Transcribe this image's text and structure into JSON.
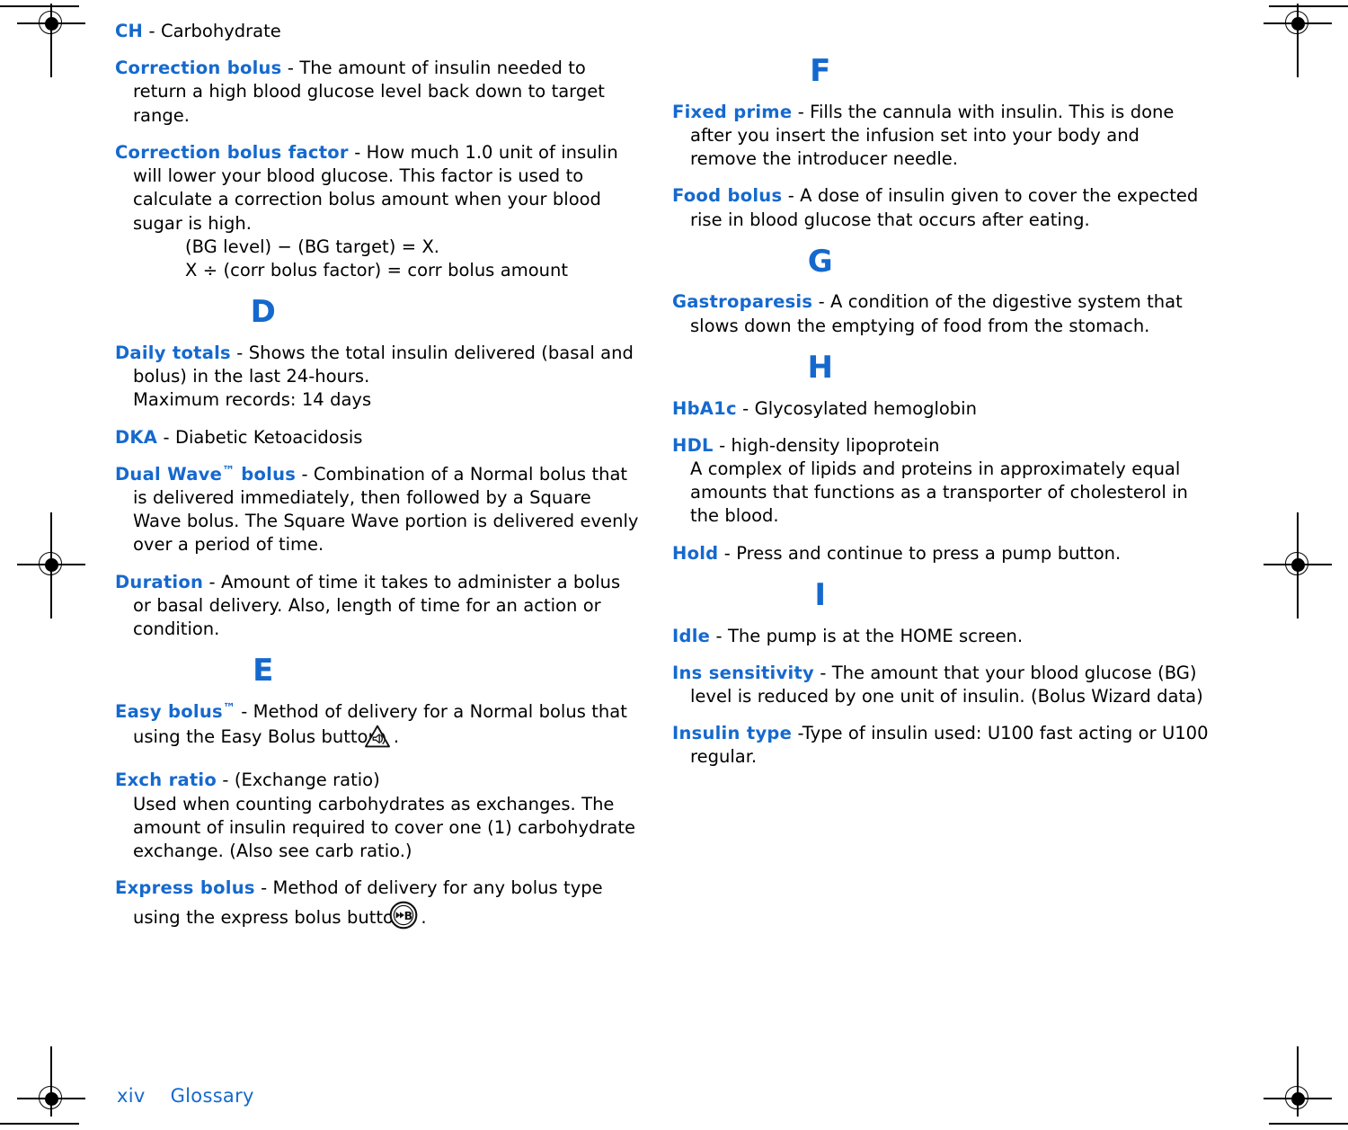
{
  "document": {
    "footer": {
      "page_number": "xiv",
      "section": "Glossary"
    }
  },
  "left_column": {
    "entries": [
      {
        "term": "CH",
        "definition": " - Carbohydrate"
      },
      {
        "term": "Correction bolus",
        "definition": " - The amount of insulin needed to return a high blood glucose level back down to target range."
      },
      {
        "term": "Correction bolus factor",
        "definition": " - How much 1.0 unit of insulin will lower your blood glucose. This factor is used to calculate a correction bolus amount when your blood sugar is high.",
        "formula_lines": [
          "(BG level) − (BG target) = X.",
          "X ÷ (corr bolus factor) = corr bolus amount"
        ]
      }
    ],
    "letter_d": "D",
    "entries_d": [
      {
        "term": "Daily totals",
        "definition": " - Shows the total insulin delivered (basal and bolus) in the last 24-hours.",
        "sub_line": "Maximum records: 14 days"
      },
      {
        "term": "DKA",
        "definition": " - Diabetic Ketoacidosis"
      },
      {
        "term": "Dual Wave",
        "trademark": "™",
        "term_tail": " bolus",
        "definition": " - Combination of a Normal bolus that is delivered immediately, then followed by a Square Wave bolus. The Square Wave portion is delivered evenly over a period of time."
      },
      {
        "term": "Duration",
        "definition": " - Amount of time it takes to administer a bolus or basal delivery. Also, length of time for an action or condition."
      }
    ],
    "letter_e": "E",
    "entries_e": [
      {
        "term": "Easy bolus",
        "trademark": "™",
        "definition_part1": " - Method of delivery for a Normal bolus that using the Easy Bolus button",
        "icon": "easy-bolus-button-icon",
        "definition_part2": "."
      },
      {
        "term": "Exch ratio",
        "definition": " - (Exchange ratio)",
        "sub_line": "Used when counting carbohydrates as exchanges. The amount of insulin required to cover one (1) carbohydrate exchange. (Also see carb ratio.)"
      },
      {
        "term": "Express bolus",
        "definition_part1": " - Method of delivery for any bolus type using the express bolus button",
        "icon": "express-bolus-button-icon",
        "definition_part2": "."
      }
    ]
  },
  "right_column": {
    "letter_f": "F",
    "entries_f": [
      {
        "term": "Fixed prime",
        "definition": " - Fills the cannula with insulin. This is done after you insert the infusion set into your body and remove the introducer needle."
      },
      {
        "term": "Food bolus",
        "definition": " - A dose of insulin given to cover the expected rise in blood glucose that occurs after eating."
      }
    ],
    "letter_g": "G",
    "entries_g": [
      {
        "term": "Gastroparesis",
        "definition": " - A condition of the digestive system that slows down the emptying of food from the stomach."
      }
    ],
    "letter_h": "H",
    "entries_h": [
      {
        "term": "HbA1c",
        "definition": " - Glycosylated hemoglobin"
      },
      {
        "term": "HDL",
        "definition": " - high-density lipoprotein",
        "sub_line": "A complex of lipids and proteins in approximately equal amounts that functions as a transporter of cholesterol in the blood."
      },
      {
        "term": "Hold",
        "definition": " - Press and continue to press a pump button."
      }
    ],
    "letter_i": "I",
    "entries_i": [
      {
        "term": "Idle",
        "definition": " - The pump is at the HOME screen."
      },
      {
        "term": "Ins sensitivity",
        "definition": " - The amount that your blood glucose (BG) level is reduced by one unit of insulin. (Bolus Wizard data)"
      },
      {
        "term": "Insulin type",
        "definition": " -Type of insulin used: U100 fast acting or U100 regular."
      }
    ]
  },
  "colors": {
    "heading_blue": "#1569ce",
    "body_text": "#000000",
    "page_background": "#ffffff"
  }
}
